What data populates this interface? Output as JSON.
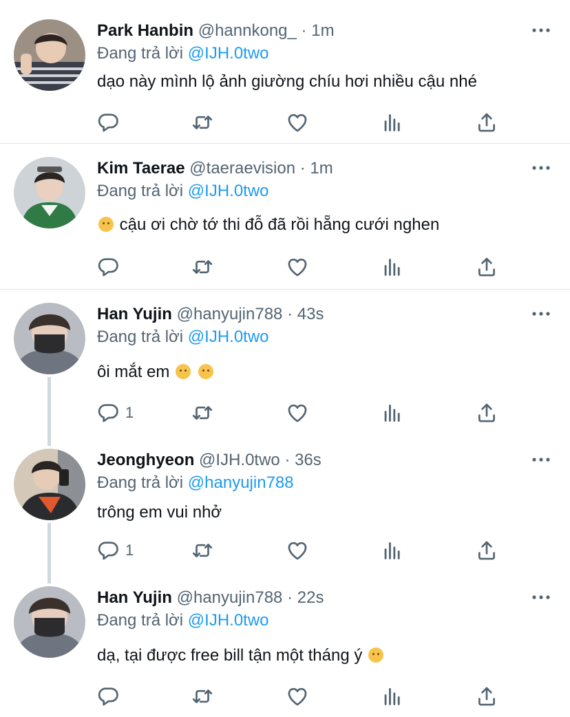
{
  "tweets": [
    {
      "name": "Park Hanbin",
      "handle": "@hannkong_",
      "dot": "·",
      "time": "1m",
      "reply_prefix": "Đang trả lời",
      "reply_to": "@IJH.0two",
      "text": "dạo này mình lộ ảnh giường chíu hơi nhiều cậu nhé",
      "reply_count": ""
    },
    {
      "name": "Kim Taerae",
      "handle": "@taeraevision",
      "dot": "·",
      "time": "1m",
      "reply_prefix": "Đang trả lời",
      "reply_to": "@IJH.0two",
      "text": "cậu ơi chờ tớ thi đỗ đã rồi hẵng cưới nghen",
      "reply_count": ""
    },
    {
      "name": "Han Yujin",
      "handle": "@hanyujin788",
      "dot": "·",
      "time": "43s",
      "reply_prefix": "Đang trả lời",
      "reply_to": "@IJH.0two",
      "text": "ôi mắt em",
      "reply_count": "1"
    },
    {
      "name": "Jeonghyeon",
      "handle": "@IJH.0two",
      "dot": "·",
      "time": "36s",
      "reply_prefix": "Đang trả lời",
      "reply_to": "@hanyujin788",
      "text": "trông em vui nhở",
      "reply_count": "1"
    },
    {
      "name": "Han Yujin",
      "handle": "@hanyujin788",
      "dot": "·",
      "time": "22s",
      "reply_prefix": "Đang trả lời",
      "reply_to": "@IJH.0two",
      "text": "dạ, tại được free bill tận một tháng ý",
      "reply_count": ""
    }
  ],
  "icons": {
    "reply": "reply-icon",
    "retweet": "retweet-icon",
    "like": "like-icon",
    "views": "views-icon",
    "share": "share-icon",
    "more": "more-icon"
  },
  "colors": {
    "text": "#0f1419",
    "secondary": "#536471",
    "mention": "#1d9bf0",
    "divider": "#e1e4e6",
    "thread_line": "#cfd9de"
  }
}
